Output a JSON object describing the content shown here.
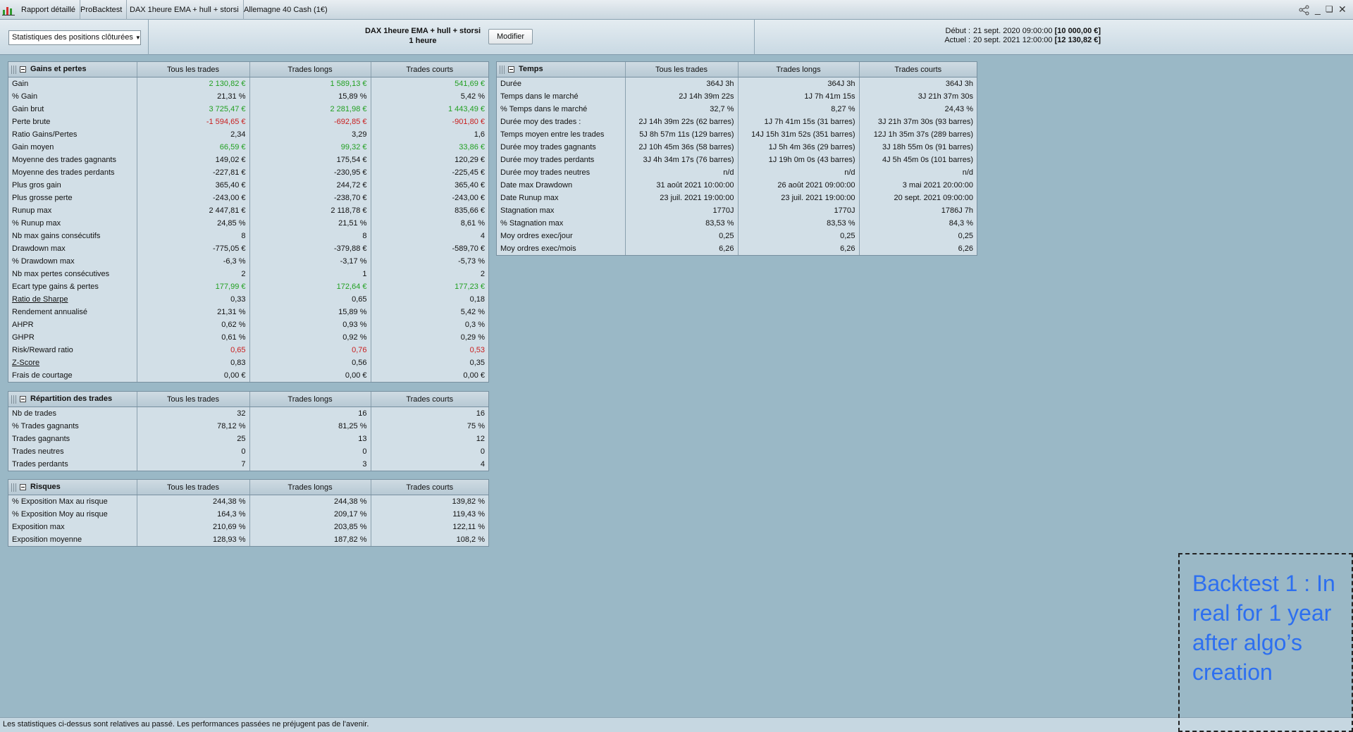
{
  "titlebar": {
    "tabs": [
      "Rapport détaillé",
      "ProBacktest",
      "DAX 1heure EMA + hull + storsi",
      "Allemagne 40 Cash (1€)"
    ]
  },
  "header": {
    "select_value": "Statistiques des positions clôturées",
    "strategy_name": "DAX 1heure EMA + hull + storsi",
    "timeframe": "1 heure",
    "modify_label": "Modifier",
    "start_label": "Début :",
    "start_date": "21 sept. 2020 09:00:00",
    "start_capital": "[10 000,00 €]",
    "current_label": "Actuel :",
    "current_date": "20 sept. 2021 12:00:00",
    "current_capital": "[12 130,82 €]"
  },
  "colors": {
    "positive": "#22a022",
    "negative": "#c81e1e",
    "annotation": "#2d6ff0"
  },
  "columns": [
    "Tous les trades",
    "Trades longs",
    "Trades courts"
  ],
  "gains": {
    "title": "Gains et pertes",
    "rows": [
      {
        "label": "Gain",
        "v": [
          "2 130,82 €",
          "1 589,13 €",
          "541,69 €"
        ],
        "c": "green"
      },
      {
        "label": "% Gain",
        "v": [
          "21,31 %",
          "15,89 %",
          "5,42 %"
        ]
      },
      {
        "label": "Gain brut",
        "v": [
          "3 725,47 €",
          "2 281,98 €",
          "1 443,49 €"
        ],
        "c": "green"
      },
      {
        "label": "Perte brute",
        "v": [
          "-1 594,65 €",
          "-692,85 €",
          "-901,80 €"
        ],
        "c": "red"
      },
      {
        "label": "Ratio Gains/Pertes",
        "v": [
          "2,34",
          "3,29",
          "1,6"
        ]
      },
      {
        "label": "Gain moyen",
        "v": [
          "66,59 €",
          "99,32 €",
          "33,86 €"
        ],
        "c": "green"
      },
      {
        "label": "Moyenne des trades gagnants",
        "v": [
          "149,02 €",
          "175,54 €",
          "120,29 €"
        ]
      },
      {
        "label": "Moyenne des trades perdants",
        "v": [
          "-227,81 €",
          "-230,95 €",
          "-225,45 €"
        ]
      },
      {
        "label": "Plus gros gain",
        "v": [
          "365,40 €",
          "244,72 €",
          "365,40 €"
        ]
      },
      {
        "label": "Plus grosse perte",
        "v": [
          "-243,00 €",
          "-238,70 €",
          "-243,00 €"
        ]
      },
      {
        "label": "Runup max",
        "v": [
          "2 447,81 €",
          "2 118,78 €",
          "835,66 €"
        ]
      },
      {
        "label": "% Runup max",
        "v": [
          "24,85 %",
          "21,51 %",
          "8,61 %"
        ]
      },
      {
        "label": "Nb max gains consécutifs",
        "v": [
          "8",
          "8",
          "4"
        ]
      },
      {
        "label": "Drawdown max",
        "v": [
          "-775,05 €",
          "-379,88 €",
          "-589,70 €"
        ]
      },
      {
        "label": "% Drawdown max",
        "v": [
          "-6,3 %",
          "-3,17 %",
          "-5,73 %"
        ]
      },
      {
        "label": "Nb max pertes consécutives",
        "v": [
          "2",
          "1",
          "2"
        ]
      },
      {
        "label": "Ecart type gains & pertes",
        "v": [
          "177,99 €",
          "172,64 €",
          "177,23 €"
        ],
        "c": "green"
      },
      {
        "label": "Ratio de Sharpe",
        "v": [
          "0,33",
          "0,65",
          "0,18"
        ],
        "u": true
      },
      {
        "label": "Rendement annualisé",
        "v": [
          "21,31 %",
          "15,89 %",
          "5,42 %"
        ]
      },
      {
        "label": "AHPR",
        "v": [
          "0,62 %",
          "0,93 %",
          "0,3 %"
        ]
      },
      {
        "label": "GHPR",
        "v": [
          "0,61 %",
          "0,92 %",
          "0,29 %"
        ]
      },
      {
        "label": "Risk/Reward ratio",
        "v": [
          "0,65",
          "0,76",
          "0,53"
        ],
        "c": "red"
      },
      {
        "label": "Z-Score",
        "v": [
          "0,83",
          "0,56",
          "0,35"
        ],
        "u": true
      },
      {
        "label": "Frais de courtage",
        "v": [
          "0,00 €",
          "0,00 €",
          "0,00 €"
        ]
      }
    ]
  },
  "repartition": {
    "title": "Répartition des trades",
    "rows": [
      {
        "label": "Nb de trades",
        "v": [
          "32",
          "16",
          "16"
        ]
      },
      {
        "label": "% Trades gagnants",
        "v": [
          "78,12 %",
          "81,25 %",
          "75 %"
        ]
      },
      {
        "label": "Trades gagnants",
        "v": [
          "25",
          "13",
          "12"
        ]
      },
      {
        "label": "Trades neutres",
        "v": [
          "0",
          "0",
          "0"
        ]
      },
      {
        "label": "Trades perdants",
        "v": [
          "7",
          "3",
          "4"
        ]
      }
    ]
  },
  "risques": {
    "title": "Risques",
    "rows": [
      {
        "label": "% Exposition Max au risque",
        "v": [
          "244,38 %",
          "244,38 %",
          "139,82 %"
        ]
      },
      {
        "label": "% Exposition Moy au risque",
        "v": [
          "164,3 %",
          "209,17 %",
          "119,43 %"
        ]
      },
      {
        "label": "Exposition max",
        "v": [
          "210,69 %",
          "203,85 %",
          "122,11 %"
        ]
      },
      {
        "label": "Exposition moyenne",
        "v": [
          "128,93 %",
          "187,82 %",
          "108,2 %"
        ]
      }
    ]
  },
  "temps": {
    "title": "Temps",
    "rows": [
      {
        "label": "Durée",
        "v": [
          "364J 3h",
          "364J 3h",
          "364J 3h"
        ]
      },
      {
        "label": "Temps dans le marché",
        "v": [
          "2J 14h 39m 22s",
          "1J 7h 41m 15s",
          "3J 21h 37m 30s"
        ]
      },
      {
        "label": "% Temps dans le marché",
        "v": [
          "32,7 %",
          "8,27 %",
          "24,43 %"
        ]
      },
      {
        "label": "Durée moy des trades :",
        "v": [
          "2J 14h 39m 22s (62 barres)",
          "1J 7h 41m 15s (31 barres)",
          "3J 21h 37m 30s (93 barres)"
        ]
      },
      {
        "label": "Temps moyen entre les trades",
        "v": [
          "5J 8h 57m 11s (129 barres)",
          "14J 15h 31m 52s (351 barres)",
          "12J 1h 35m 37s (289 barres)"
        ]
      },
      {
        "label": "Durée moy trades gagnants",
        "v": [
          "2J 10h 45m 36s (58 barres)",
          "1J 5h 4m 36s (29 barres)",
          "3J 18h 55m 0s (91 barres)"
        ]
      },
      {
        "label": "Durée moy trades perdants",
        "v": [
          "3J 4h 34m 17s (76 barres)",
          "1J 19h 0m 0s (43 barres)",
          "4J 5h 45m 0s (101 barres)"
        ]
      },
      {
        "label": "Durée moy trades neutres",
        "v": [
          "n/d",
          "n/d",
          "n/d"
        ]
      },
      {
        "label": "Date max Drawdown",
        "v": [
          "31 août 2021 10:00:00",
          "26 août 2021 09:00:00",
          "3 mai 2021 20:00:00"
        ]
      },
      {
        "label": "Date Runup max",
        "v": [
          "23 juil. 2021 19:00:00",
          "23 juil. 2021 19:00:00",
          "20 sept. 2021 09:00:00"
        ]
      },
      {
        "label": "Stagnation max",
        "v": [
          "1770J",
          "1770J",
          "1786J 7h"
        ]
      },
      {
        "label": "% Stagnation max",
        "v": [
          "83,53 %",
          "83,53 %",
          "84,3 %"
        ]
      },
      {
        "label": "Moy ordres exec/jour",
        "v": [
          "0,25",
          "0,25",
          "0,25"
        ]
      },
      {
        "label": "Moy ordres exec/mois",
        "v": [
          "6,26",
          "6,26",
          "6,26"
        ]
      }
    ]
  },
  "footer": {
    "text": "Les statistiques ci-dessus sont relatives au passé. Les performances passées ne préjugent pas de l'avenir."
  },
  "annotation": {
    "text": "Backtest 1 : In real for 1 year after algo’s creation"
  }
}
